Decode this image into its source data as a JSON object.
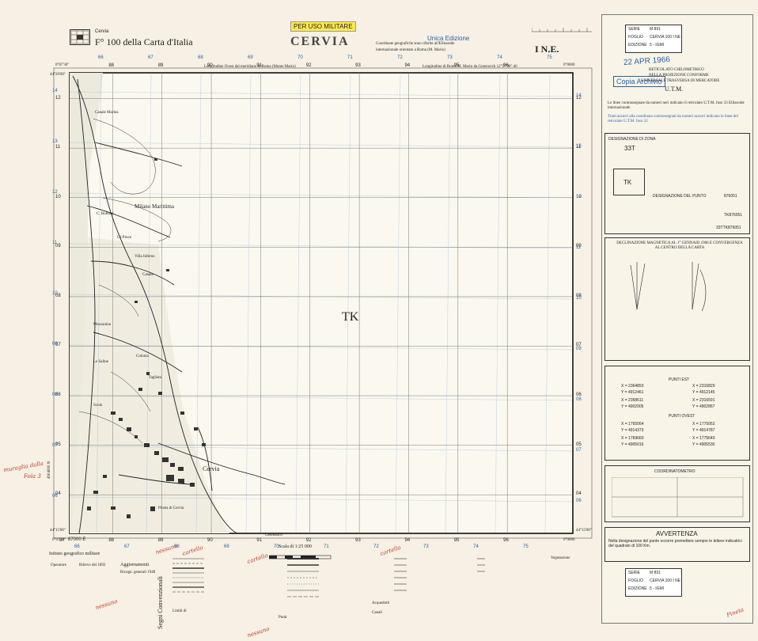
{
  "header": {
    "city_label": "Cervia",
    "sheet_title": "F° 100 della Carta d'Italia",
    "stamp": "PER USO MILITARE",
    "map_name": "CERVIA",
    "edition_note": "Unica Edizione",
    "coord_note_1": "Coordinate geografiche sono riferite all'Ellissoide",
    "coord_note_2": "internazionale orientato a Roma (M. Mario)",
    "quadrant": "I N.E.",
    "longitude_left": "Longitudine Ovest dal meridiano di Roma (Monte Mario)",
    "longitude_right": "Longitudine di Roma M. Mario da Greenwich 12°27'08\".40",
    "corner_tl": "0°07'30\"",
    "corner_tr": "0°0000",
    "lat_tl": "44°20'00\"",
    "lat_bl": "44°15'00\"",
    "corner_bl": "0°07'30\"",
    "corner_br": "0°0000",
    "lat_br": "44°15'00\""
  },
  "grid": {
    "top_black": [
      "88",
      "89",
      "90",
      "91",
      "92",
      "93",
      "94",
      "95",
      "96"
    ],
    "top_blue": [
      "66",
      "67",
      "68",
      "69",
      "70",
      "71",
      "72",
      "73",
      "74",
      "75"
    ],
    "bottom_black": [
      "87",
      "88",
      "89",
      "90",
      "91",
      "92",
      "93",
      "94",
      "95",
      "96"
    ],
    "bottom_blue": [
      "66",
      "67",
      "68",
      "69",
      "70",
      "71",
      "72",
      "73",
      "74",
      "75"
    ],
    "left_black": [
      "12",
      "11",
      "10",
      "09",
      "08",
      "07",
      "06",
      "05",
      "04"
    ],
    "left_blue": [
      "14",
      "13",
      "12",
      "11",
      "10",
      "09",
      "08",
      "07",
      "06"
    ],
    "right_black": [
      "12",
      "11",
      "10",
      "09",
      "08",
      "07",
      "06",
      "05",
      "04"
    ],
    "right_blue": [
      "14",
      "13",
      "12",
      "11",
      "10",
      "09",
      "08",
      "07",
      "06"
    ],
    "zone_label": "TK",
    "bottom_corner_label": "87000 E",
    "left_lower_label": "4904000 N"
  },
  "places": [
    "Cesenatico",
    "Canale Marina",
    "C. Bolbani",
    "Cà Pesce",
    "Milano Marittima",
    "Colonia",
    "Cervia",
    "Mezzanino",
    "Le Saline",
    "Pineta di Cervia",
    "Tagliata",
    "Scolo",
    "Canale",
    "Villa Inferno"
  ],
  "right_panel": {
    "serie_box": {
      "serie": "SERIE",
      "serie_val": "M 891",
      "foglio": "FOGLIO",
      "foglio_val": "CERVIA 100 I NE",
      "edizione": "EDIZIONE",
      "edizione_val": "5 - IGMI"
    },
    "date_stamp": "22 APR 1966",
    "copia_stamp": "Copia Archivio",
    "utm_title_1": "RETICOLATO CHILOMETRICO",
    "utm_title_2": "NELLA PROIEZIONE CONFORME",
    "utm_title_3": "UNIVERSALE TRASVERSA DI MERCATORE",
    "utm_title_4": "U.T.M.",
    "utm_notes": "Le linee contrassegnate da numeri neri indicano il reticolato U.T.M. fuso 33 Ellissoide internazionale",
    "blue_notes": "Tratti azzurri alla coordinata contrassegnati da numeri azzurri indicano le linee del reticolato U.T.M. fuso 32",
    "zone_header": "DESIGNAZIONE DI ZONA",
    "zone_value": "33T",
    "square_label": "TK",
    "designation_header": "DESIGNAZIONE DEL PUNTO",
    "designation_value": "876051",
    "designation_value_2": "TK876051",
    "designation_value_3": "33TTK876051",
    "magnetic_title": "DECLINAZIONE MAGNETICA AL 1° GENNAIO 1966 E CONVERGENZA AL CENTRO DELLA CARTA",
    "coords_title": "PUNTI EST",
    "coords_title_2": "PUNTI OVEST",
    "coords": [
      "X = 2364893",
      "Y = 4912461",
      "X = 2316829",
      "Y = 4912145",
      "X = 2358611",
      "Y = 4902005",
      "X = 2316591",
      "Y = 4902867",
      "X = 1765064",
      "Y = 4914373",
      "X = 1775052",
      "Y = 4914787",
      "X = 1769660",
      "Y = 4905016",
      "X = 1775640",
      "Y = 4905530"
    ],
    "coordinatometro": "COORDINATOMETRO",
    "warning_title": "AVVERTENZA",
    "warning_text": "Nella designazione del punto occorre premettere sempre le lettere indicatrici del quadrato di 100 Km.",
    "serie_box_2": {
      "serie": "SERIE",
      "serie_val": "M 891",
      "foglio": "FOGLIO",
      "foglio_val": "CERVIA 100 I NE",
      "edizione": "EDIZIONE",
      "edizione_val": "5 - IGMI"
    }
  },
  "bottom": {
    "institute": "Istituto geografico militare",
    "operators": "Operatore",
    "surveyed": "Rilievo del 1892",
    "updates_title": "Aggiornamenti",
    "updates_value": "Ricogn. generali 1948",
    "scale_label": "Scala di 1:25 000",
    "conventional_signs": "Segni Convenzionali",
    "legend_left_title": "Limiti di",
    "canali": "Canali",
    "acquedotti": "Acquedotti",
    "punti": "Punti",
    "vegetazione": "Vegetazione"
  },
  "annotations": {
    "left_margin": "muraglia dalla",
    "left_margin_2": "Fola 3",
    "bottom_notes": [
      "nessuno",
      "cartello",
      "cartello",
      "nessuno",
      "cartello",
      "nessuno"
    ],
    "bottom_right": "Pineta"
  }
}
